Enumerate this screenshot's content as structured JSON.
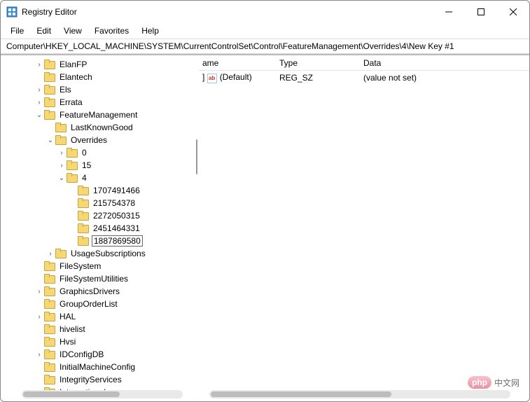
{
  "window": {
    "title": "Registry Editor"
  },
  "menubar": [
    "File",
    "Edit",
    "View",
    "Favorites",
    "Help"
  ],
  "address": "Computer\\HKEY_LOCAL_MACHINE\\SYSTEM\\CurrentControlSet\\Control\\FeatureManagement\\Overrides\\4\\New Key #1",
  "columns": {
    "name": "ame",
    "type": "Type",
    "data": "Data"
  },
  "values": [
    {
      "icon": "string-value-icon",
      "name": "(Default)",
      "type": "REG_SZ",
      "data": "(value not set)"
    }
  ],
  "name_prefix_cutoff": "]",
  "tree": [
    {
      "label": "ElanFP",
      "depth": 3,
      "tw": "closed"
    },
    {
      "label": "Elantech",
      "depth": 3,
      "tw": "none"
    },
    {
      "label": "Els",
      "depth": 3,
      "tw": "closed"
    },
    {
      "label": "Errata",
      "depth": 3,
      "tw": "closed"
    },
    {
      "label": "FeatureManagement",
      "depth": 3,
      "tw": "open"
    },
    {
      "label": "LastKnownGood",
      "depth": 4,
      "tw": "none"
    },
    {
      "label": "Overrides",
      "depth": 4,
      "tw": "open"
    },
    {
      "label": "0",
      "depth": 5,
      "tw": "closed"
    },
    {
      "label": "15",
      "depth": 5,
      "tw": "closed"
    },
    {
      "label": "4",
      "depth": 5,
      "tw": "open"
    },
    {
      "label": "1707491466",
      "depth": 6,
      "tw": "none"
    },
    {
      "label": "215754378",
      "depth": 6,
      "tw": "none"
    },
    {
      "label": "2272050315",
      "depth": 6,
      "tw": "none"
    },
    {
      "label": "2451464331",
      "depth": 6,
      "tw": "none"
    },
    {
      "label": "1887869580",
      "depth": 6,
      "tw": "none",
      "editing": true
    },
    {
      "label": "UsageSubscriptions",
      "depth": 4,
      "tw": "closed"
    },
    {
      "label": "FileSystem",
      "depth": 3,
      "tw": "none"
    },
    {
      "label": "FileSystemUtilities",
      "depth": 3,
      "tw": "none"
    },
    {
      "label": "GraphicsDrivers",
      "depth": 3,
      "tw": "closed"
    },
    {
      "label": "GroupOrderList",
      "depth": 3,
      "tw": "none"
    },
    {
      "label": "HAL",
      "depth": 3,
      "tw": "closed"
    },
    {
      "label": "hivelist",
      "depth": 3,
      "tw": "none"
    },
    {
      "label": "Hvsi",
      "depth": 3,
      "tw": "none"
    },
    {
      "label": "IDConfigDB",
      "depth": 3,
      "tw": "closed"
    },
    {
      "label": "InitialMachineConfig",
      "depth": 3,
      "tw": "none"
    },
    {
      "label": "IntegrityServices",
      "depth": 3,
      "tw": "none"
    },
    {
      "label": "International",
      "depth": 3,
      "tw": "closed"
    }
  ],
  "watermark": {
    "logo": "php",
    "text": "中文网"
  }
}
